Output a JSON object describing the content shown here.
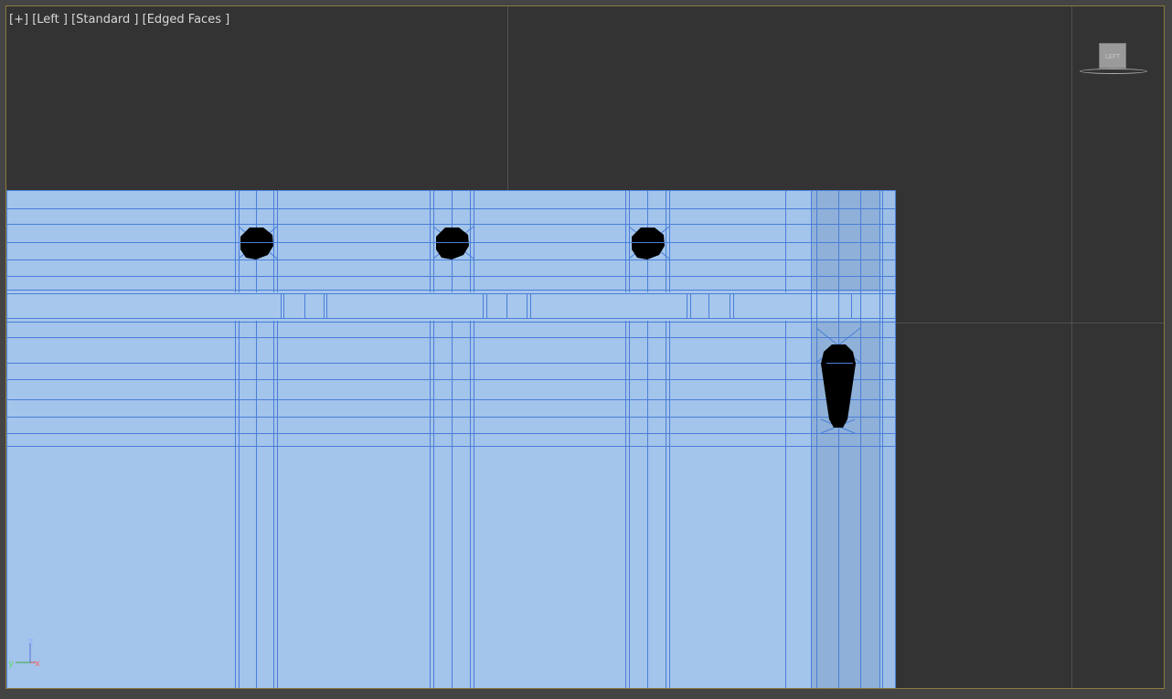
{
  "viewport": {
    "label_plus": "[+]",
    "label_view": "[Left ]",
    "label_shading": "[Standard ]",
    "label_edged": "[Edged Faces ]"
  },
  "viewcube": {
    "face_label": "LEFT"
  },
  "axes": {
    "vertical": "z",
    "horizontal_left": "y",
    "horizontal_right": "x"
  },
  "colors": {
    "mesh_fill": "#a3c4eb",
    "mesh_dark_column": "#8fb0d8",
    "wire": "#4a7fd8",
    "hole": "#000000",
    "viewport_bg": "#333333",
    "active_border": "#8a7a3a"
  }
}
